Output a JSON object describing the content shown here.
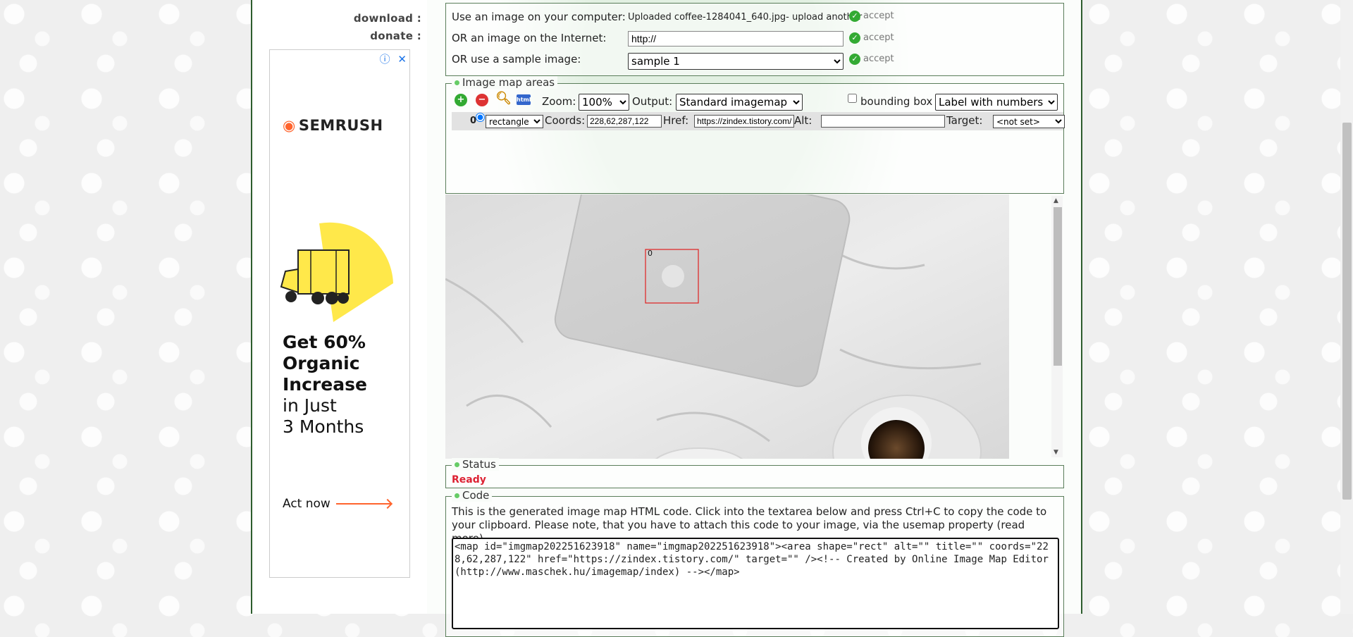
{
  "side_menu": {
    "download_label": "download :",
    "donate_label": "donate :"
  },
  "ad": {
    "brand": "SEMRUSH",
    "headline_bold": [
      "Get 60%",
      "Organic",
      "Increase"
    ],
    "headline_rest": [
      "in Just",
      "3 Months"
    ],
    "cta": "Act now",
    "info_icon": "info-icon",
    "close_icon": "close-icon",
    "accent_color": "#ff642d",
    "illustration_color": "#ffe84a"
  },
  "source": {
    "computer_label": "Use an image on your computer:",
    "uploaded_text": "Uploaded coffee-1284041_640.jpg-",
    "upload_another": "upload another",
    "internet_label": "OR an image on the Internet:",
    "internet_value": "http://",
    "sample_label": "OR use a sample image:",
    "sample_value": "sample 1",
    "accept_label": "accept"
  },
  "areas": {
    "legend": "Image map areas",
    "zoom_label": "Zoom:",
    "zoom_value": "100%",
    "output_label": "Output:",
    "output_value": "Standard imagemap",
    "bounding_box_label": "bounding box",
    "label_mode": "Label with numbers",
    "row": {
      "index": "0",
      "shape": "rectangle",
      "coords_label": "Coords:",
      "coords_value": "228,62,287,122",
      "href_label": "Href:",
      "href_value": "https://zindex.tistory.com/",
      "alt_label": "Alt:",
      "alt_value": "",
      "target_label": "Target:",
      "target_value": "<not set>"
    },
    "area_label": "0"
  },
  "status": {
    "legend": "Status",
    "text": "Ready",
    "color": "#dd2233"
  },
  "code": {
    "legend": "Code",
    "description": "This is the generated image map HTML code. Click into the textarea below and press Ctrl+C to copy the code to your clipboard. Please note, that you have to attach this code to your image, via the usemap property (read more).",
    "textarea": "<map id=\"imgmap202251623918\" name=\"imgmap202251623918\"><area shape=\"rect\" alt=\"\" title=\"\" coords=\"228,62,287,122\" href=\"https://zindex.tistory.com/\" target=\"\" /><!-- Created by Online Image Map Editor (http://www.maschek.hu/imagemap/index) --></map>"
  }
}
